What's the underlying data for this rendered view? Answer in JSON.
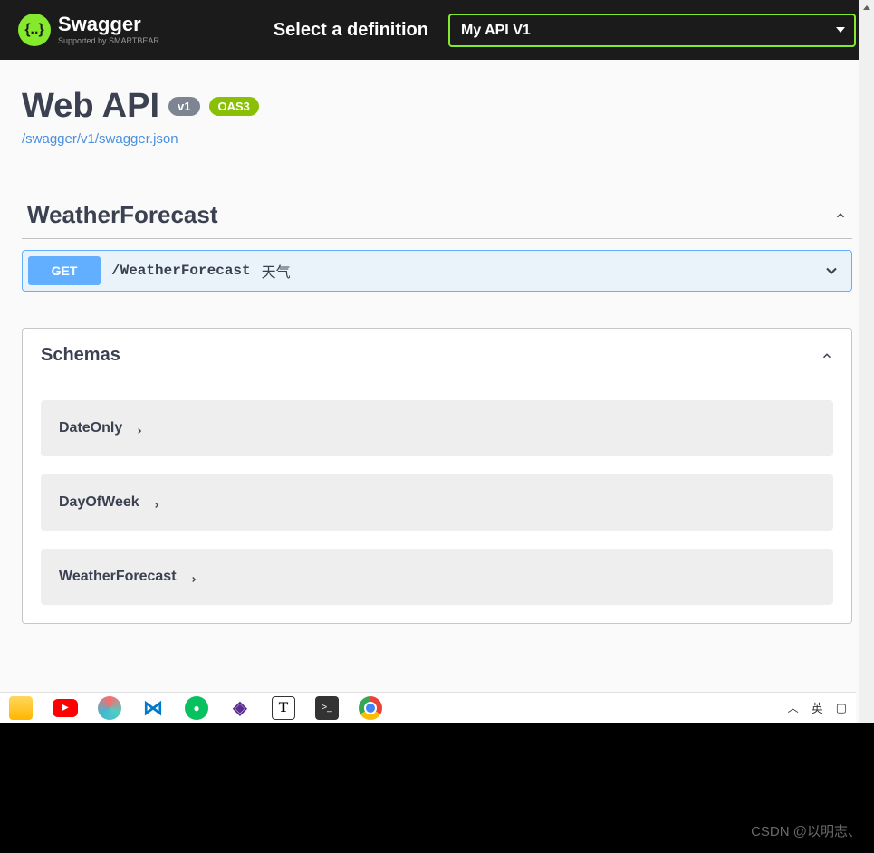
{
  "topbar": {
    "brand": "Swagger",
    "brand_sub": "Supported by SMARTBEAR",
    "select_label": "Select a definition",
    "selected_definition": "My API V1"
  },
  "api": {
    "title": "Web API",
    "version": "v1",
    "oas": "OAS3",
    "spec_url": "/swagger/v1/swagger.json"
  },
  "tags": [
    {
      "name": "WeatherForecast",
      "operations": [
        {
          "method": "GET",
          "path": "/WeatherForecast",
          "summary": "天气"
        }
      ]
    }
  ],
  "schemas": {
    "title": "Schemas",
    "items": [
      {
        "name": "DateOnly"
      },
      {
        "name": "DayOfWeek"
      },
      {
        "name": "WeatherForecast"
      }
    ]
  },
  "taskbar": {
    "ime": "英"
  },
  "watermark": "CSDN @以明志、"
}
